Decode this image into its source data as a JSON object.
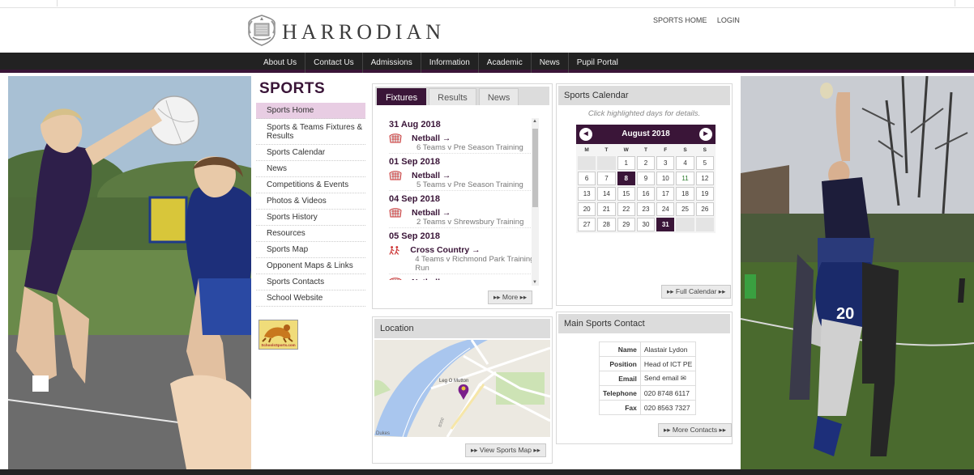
{
  "brand": {
    "name": "HARRODIAN"
  },
  "top_links": {
    "sports_home": "SPORTS HOME",
    "login": "LOGIN"
  },
  "nav": [
    "About Us",
    "Contact Us",
    "Admissions",
    "Information",
    "Academic",
    "News",
    "Pupil Portal"
  ],
  "sidebar": {
    "title": "SPORTS",
    "items": [
      "Sports Home",
      "Sports & Teams Fixtures & Results",
      "Sports Calendar",
      "News",
      "Competitions & Events",
      "Photos & Videos",
      "Sports History",
      "Resources",
      "Sports Map",
      "Opponent Maps & Links",
      "Sports Contacts",
      "School Website"
    ],
    "active_index": 0,
    "badge_label": "SchoolsSports.com"
  },
  "fixtures": {
    "tabs": [
      "Fixtures",
      "Results",
      "News"
    ],
    "active_tab": 0,
    "groups": [
      {
        "date": "31 Aug 2018",
        "items": [
          {
            "sport": "Netball →",
            "detail": "6 Teams v Pre Season Training",
            "icon": "netball-icon"
          }
        ]
      },
      {
        "date": "01 Sep 2018",
        "items": [
          {
            "sport": "Netball →",
            "detail": "5 Teams v Pre Season Training",
            "icon": "netball-icon"
          }
        ]
      },
      {
        "date": "04 Sep 2018",
        "items": [
          {
            "sport": "Netball →",
            "detail": "2 Teams v Shrewsbury Training",
            "icon": "netball-icon"
          }
        ]
      },
      {
        "date": "05 Sep 2018",
        "items": [
          {
            "sport": "Cross Country →",
            "detail": "4 Teams v Richmond Park Training Run",
            "icon": "runners-icon"
          },
          {
            "sport": "Netball →",
            "detail": "",
            "icon": "netball-icon"
          }
        ]
      }
    ],
    "more_label": "▸▸ More ▸▸"
  },
  "calendar": {
    "title": "Sports Calendar",
    "hint": "Click highlighted days for details.",
    "month": "August 2018",
    "weekdays": [
      "M",
      "T",
      "W",
      "T",
      "F",
      "S",
      "S"
    ],
    "weeks": [
      [
        "",
        "",
        "1",
        "2",
        "3",
        "4",
        "5"
      ],
      [
        "6",
        "7",
        "8",
        "9",
        "10",
        "11",
        "12"
      ],
      [
        "13",
        "14",
        "15",
        "16",
        "17",
        "18",
        "19"
      ],
      [
        "20",
        "21",
        "22",
        "23",
        "24",
        "25",
        "26"
      ],
      [
        "27",
        "28",
        "29",
        "30",
        "31",
        "",
        ""
      ]
    ],
    "highlighted": [
      "8",
      "31"
    ],
    "green": [
      "11"
    ],
    "full_label": "▸▸ Full Calendar ▸▸"
  },
  "location": {
    "title": "Location",
    "map_labels": [
      "Leg O Mutton",
      "Dukes",
      "B350"
    ],
    "view_label": "▸▸ View Sports Map ▸▸"
  },
  "contact": {
    "title": "Main Sports Contact",
    "rows": [
      {
        "k": "Name",
        "v": "Alastair Lydon"
      },
      {
        "k": "Position",
        "v": "Head of ICT PE"
      },
      {
        "k": "Email",
        "v": "Send email ✉"
      },
      {
        "k": "Telephone",
        "v": "020 8748 6117"
      },
      {
        "k": "Fax",
        "v": "020 8563 7327"
      }
    ],
    "more_label": "▸▸ More Contacts ▸▸"
  },
  "colors": {
    "brand_purple": "#3a1538",
    "nav_bg": "#222222",
    "active_side": "#e8cde3"
  }
}
